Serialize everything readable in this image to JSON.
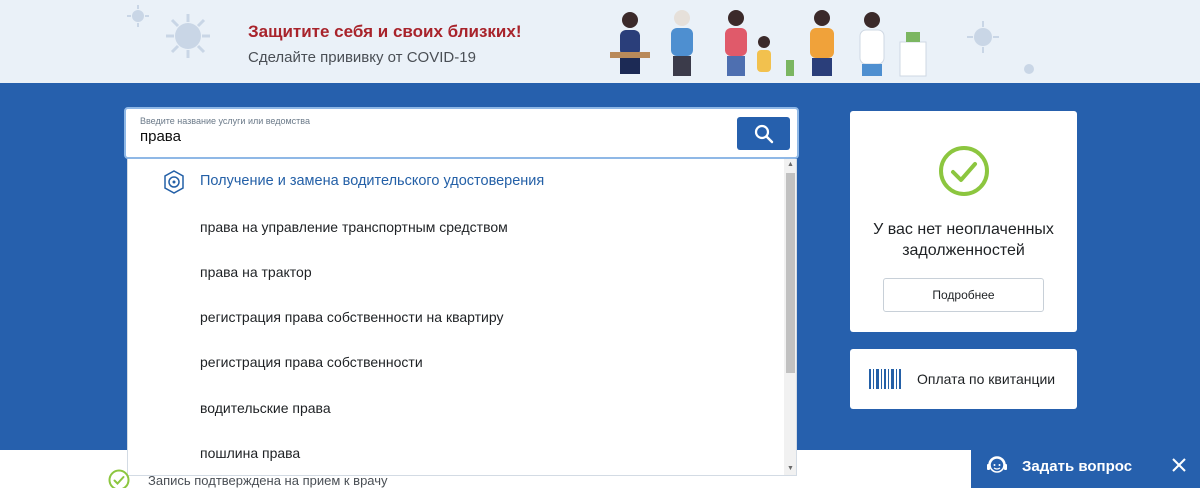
{
  "banner": {
    "title": "Защитите себя и своих близких!",
    "subtitle": "Сделайте прививку от COVID-19"
  },
  "search": {
    "label": "Введите название услуги или ведомства",
    "value": "права"
  },
  "suggestions": [
    {
      "text": "Получение и замена водительского удостоверения",
      "primary": true
    },
    {
      "text": "права на управление транспортным средством"
    },
    {
      "text": "права на трактор"
    },
    {
      "text": "регистрация права собственности на квартиру"
    },
    {
      "text": "регистрация права собственности"
    },
    {
      "text": "водительские права"
    },
    {
      "text": "пошлина права"
    }
  ],
  "debt_card": {
    "text": "У вас нет неоплаченных задолженностей",
    "button": "Подробнее"
  },
  "pay_card": {
    "text": "Оплата по квитанции"
  },
  "notice": {
    "text": "Запись подтверждена на прием к врачу"
  },
  "ask": {
    "text": "Задать вопрос"
  },
  "colors": {
    "brand_blue": "#2660ad",
    "banner_red": "#a8232b",
    "link_blue": "#2460a7",
    "success_green": "#8cc63f"
  }
}
